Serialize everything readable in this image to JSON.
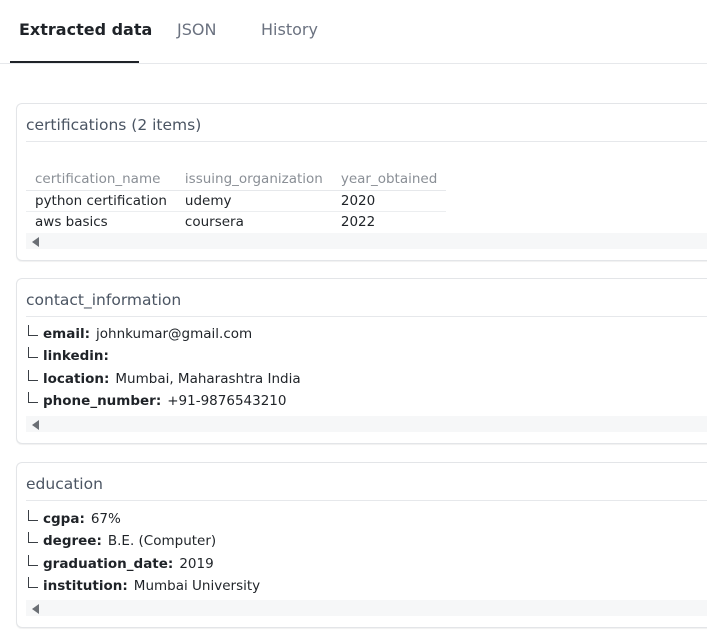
{
  "tabs": [
    {
      "label": "Extracted data",
      "active": true
    },
    {
      "label": "JSON",
      "active": false
    },
    {
      "label": "History",
      "active": false
    }
  ],
  "certifications": {
    "title": "certifications (2 items)",
    "columns": [
      "certification_name",
      "issuing_organization",
      "year_obtained"
    ],
    "rows": [
      [
        "python certification",
        "udemy",
        "2020"
      ],
      [
        "aws basics",
        "coursera",
        "2022"
      ]
    ]
  },
  "contact_information": {
    "title": "contact_information",
    "fields": [
      {
        "key": "email:",
        "value": "johnkumar@gmail.com"
      },
      {
        "key": "linkedin:",
        "value": ""
      },
      {
        "key": "location:",
        "value": "Mumbai, Maharashtra India"
      },
      {
        "key": "phone_number:",
        "value": "+91-9876543210"
      }
    ]
  },
  "education": {
    "title": "education",
    "fields": [
      {
        "key": "cgpa:",
        "value": "67%"
      },
      {
        "key": "degree:",
        "value": "B.E. (Computer)"
      },
      {
        "key": "graduation_date:",
        "value": "2019"
      },
      {
        "key": "institution:",
        "value": "Mumbai University"
      }
    ]
  },
  "colors": {
    "accent": "#1f2328",
    "muted": "#6b7280",
    "border": "#e3e5e8"
  },
  "icons": {
    "branch": "tree-branch-icon",
    "scroll_left": "scroll-left-arrow-icon"
  }
}
